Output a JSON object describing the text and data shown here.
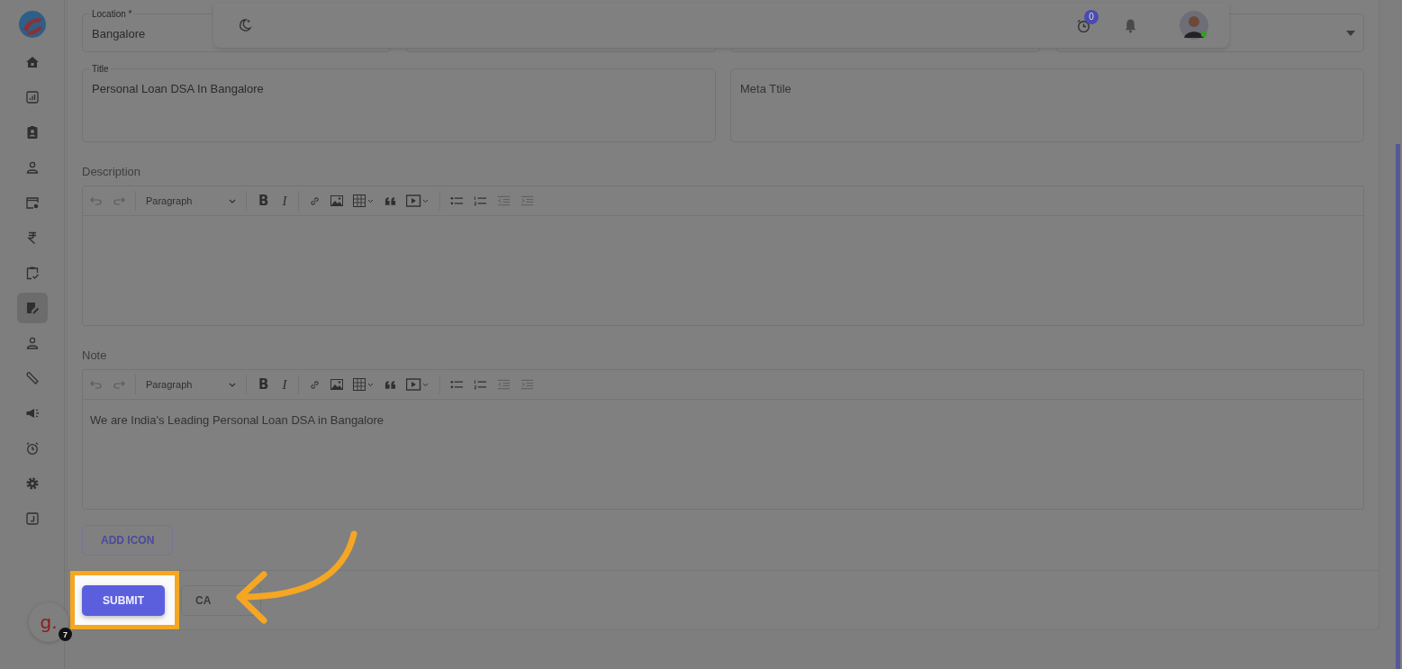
{
  "sidebar": {
    "items": [
      {
        "kind": "home",
        "selected": false
      },
      {
        "kind": "chart",
        "selected": false
      },
      {
        "kind": "contact",
        "selected": false
      },
      {
        "kind": "person",
        "selected": false
      },
      {
        "kind": "window",
        "selected": false
      },
      {
        "kind": "rupee",
        "selected": false
      },
      {
        "kind": "clipboard",
        "selected": false
      },
      {
        "kind": "edit",
        "selected": true
      },
      {
        "kind": "person",
        "selected": false
      },
      {
        "kind": "wrench",
        "selected": false
      },
      {
        "kind": "megaphone",
        "selected": false
      },
      {
        "kind": "alarm",
        "selected": false
      },
      {
        "kind": "settings",
        "selected": false
      },
      {
        "kind": "jbox",
        "selected": false
      }
    ]
  },
  "header": {
    "timer_badge": "0"
  },
  "form": {
    "top_fields": [
      {
        "label": "Location *",
        "value": "Bangalore",
        "kind": "text"
      },
      {
        "kind": "text"
      },
      {
        "kind": "text"
      },
      {
        "kind": "select"
      }
    ],
    "title_field": {
      "label": "Title",
      "value": "Personal Loan DSA In Bangalore"
    },
    "meta_title_field": {
      "placeholder": "Meta Ttile"
    },
    "editors": [
      {
        "label": "Description",
        "block_format": "Paragraph",
        "bold": "B",
        "italic": "I"
      },
      {
        "label": "Note",
        "block_format": "Paragraph",
        "bold": "B",
        "italic": "I",
        "content": "We are India's Leading Personal Loan DSA in Bangalore"
      }
    ],
    "add_icon_button": "ADD ICON",
    "submit_button": "SUBMIT",
    "cancel_button": "CA"
  },
  "chat_widget": {
    "letter": "g.",
    "badge": "7"
  }
}
